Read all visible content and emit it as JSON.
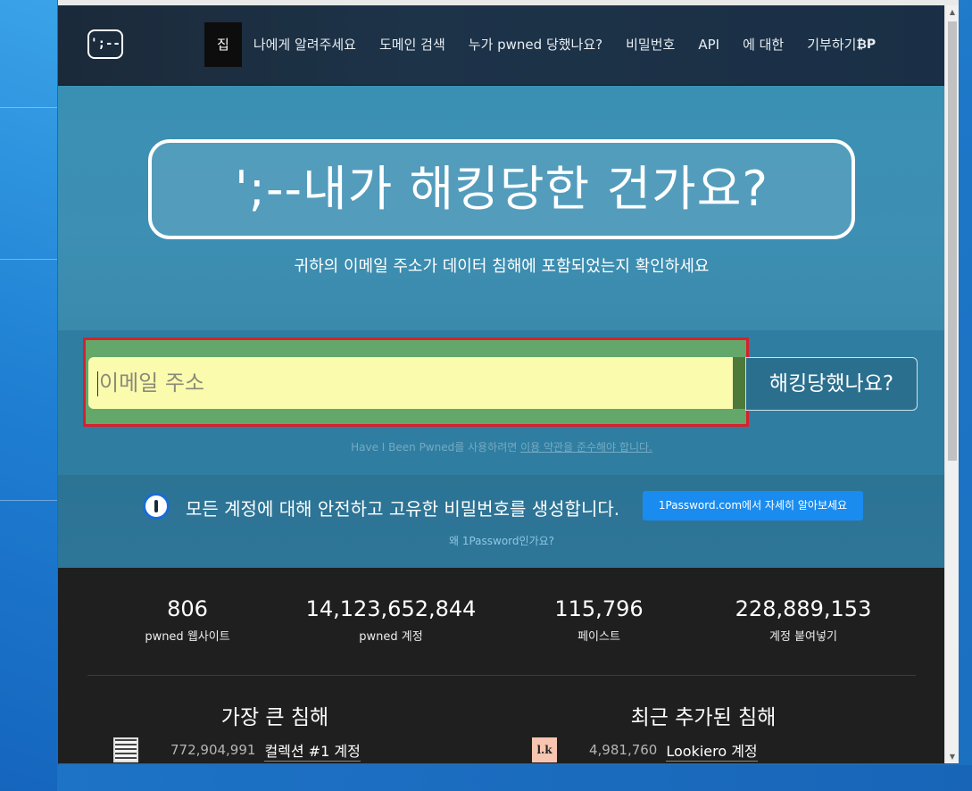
{
  "nav": {
    "logo_text": "';--",
    "items": [
      "집",
      "나에게 알려주세요",
      "도메인 검색",
      "누가 pwned 당했나요?",
      "비밀번호",
      "API",
      "에 대한"
    ],
    "donate_label": "기부하기",
    "donate_coin_1": "₿",
    "donate_coin_2": "P"
  },
  "hero": {
    "title": "';--내가 해킹당한 건가요?",
    "subtitle": "귀하의 이메일 주소가 데이터 침해에 포함되었는지 확인하세요"
  },
  "search": {
    "placeholder": "이메일 주소",
    "button_label": "해킹당했나요?",
    "tos_prefix": "Have I Been Pwned를 사용하려면 ",
    "tos_link": "이용 약관을 준수해야 합니다."
  },
  "promo": {
    "text": "모든 계정에 대해 안전하고 고유한 비밀번호를 생성합니다.",
    "button_label": "1Password.com에서 자세히 알아보세요",
    "why_label": "왜 1Password인가요?"
  },
  "stats": [
    {
      "value": "806",
      "label": "pwned 웹사이트"
    },
    {
      "value": "14,123,652,844",
      "label": "pwned 계정"
    },
    {
      "value": "115,796",
      "label": "페이스트"
    },
    {
      "value": "228,889,153",
      "label": "계정 붙여넣기"
    }
  ],
  "largest": {
    "title": "가장 큰 침해",
    "first_count": "772,904,991",
    "first_name": "컬렉션 #1 계정"
  },
  "recent": {
    "title": "최근 추가된 침해",
    "first_icon_text": "l.k",
    "first_count": "4,981,760",
    "first_name": "Lookiero 계정"
  },
  "colors": {
    "hero_bg": "#3a90b3",
    "input_bg": "#fbfbae",
    "highlight_border": "#d9202a",
    "promo_button": "#1a8cf0"
  }
}
